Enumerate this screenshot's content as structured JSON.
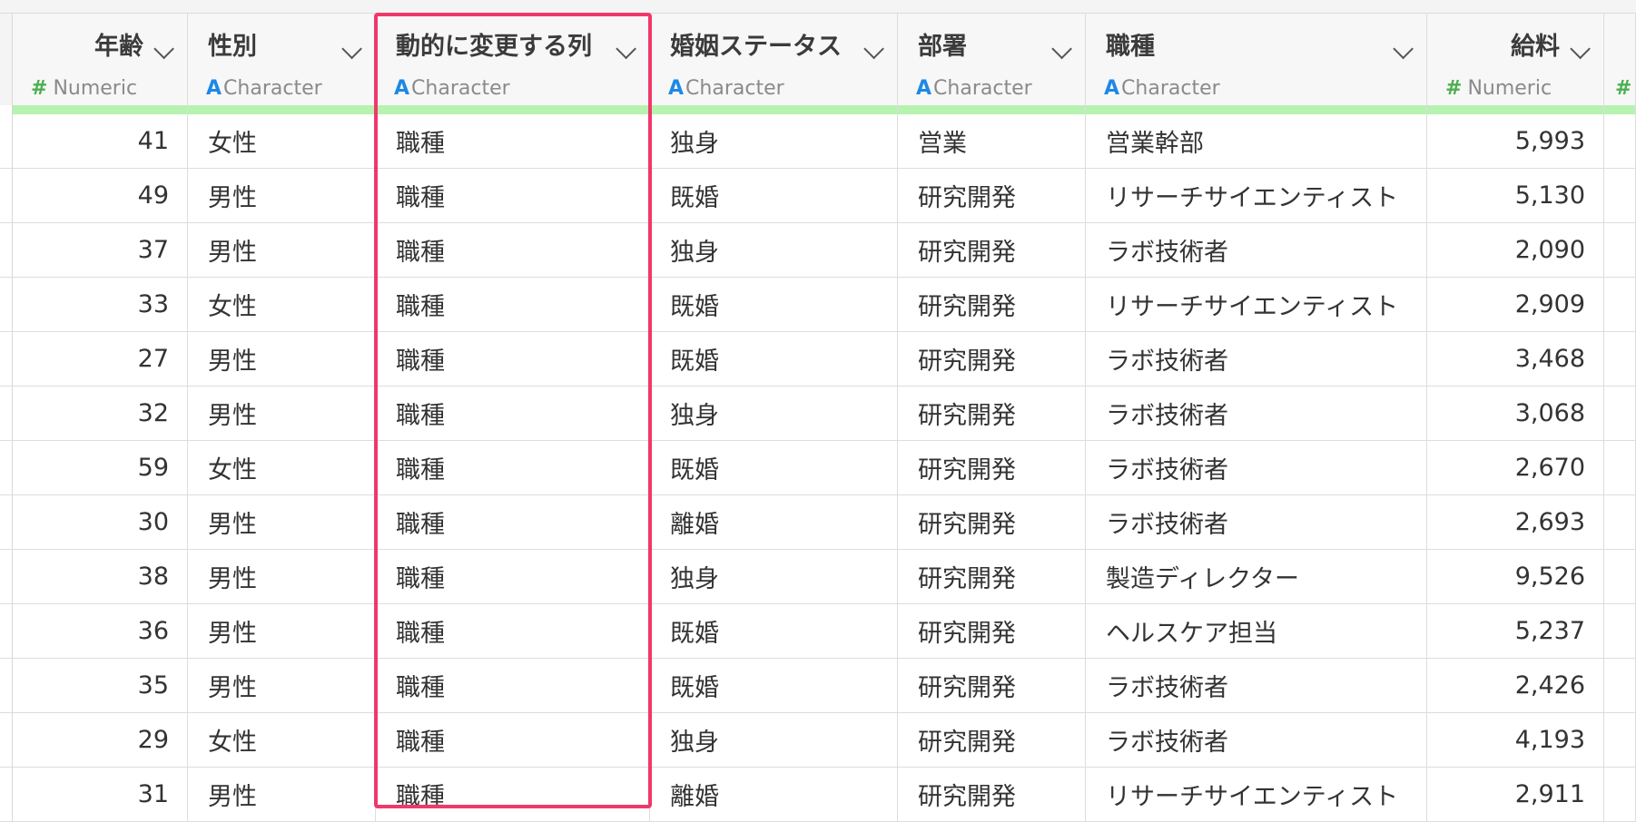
{
  "columns": [
    {
      "name": "年齢",
      "type_glyph": "#",
      "type": "Numeric"
    },
    {
      "name": "性別",
      "type_glyph": "A",
      "type": "Character"
    },
    {
      "name": "動的に変更する列",
      "type_glyph": "A",
      "type": "Character"
    },
    {
      "name": "婚姻ステータス",
      "type_glyph": "A",
      "type": "Character"
    },
    {
      "name": "部署",
      "type_glyph": "A",
      "type": "Character"
    },
    {
      "name": "職種",
      "type_glyph": "A",
      "type": "Character"
    },
    {
      "name": "給料",
      "type_glyph": "#",
      "type": "Numeric"
    }
  ],
  "partial_column_glyph": "#",
  "rows": [
    [
      "41",
      "女性",
      "職種",
      "独身",
      "営業",
      "営業幹部",
      "5,993"
    ],
    [
      "49",
      "男性",
      "職種",
      "既婚",
      "研究開発",
      "リサーチサイエンティスト",
      "5,130"
    ],
    [
      "37",
      "男性",
      "職種",
      "独身",
      "研究開発",
      "ラボ技術者",
      "2,090"
    ],
    [
      "33",
      "女性",
      "職種",
      "既婚",
      "研究開発",
      "リサーチサイエンティスト",
      "2,909"
    ],
    [
      "27",
      "男性",
      "職種",
      "既婚",
      "研究開発",
      "ラボ技術者",
      "3,468"
    ],
    [
      "32",
      "男性",
      "職種",
      "独身",
      "研究開発",
      "ラボ技術者",
      "3,068"
    ],
    [
      "59",
      "女性",
      "職種",
      "既婚",
      "研究開発",
      "ラボ技術者",
      "2,670"
    ],
    [
      "30",
      "男性",
      "職種",
      "離婚",
      "研究開発",
      "ラボ技術者",
      "2,693"
    ],
    [
      "38",
      "男性",
      "職種",
      "独身",
      "研究開発",
      "製造ディレクター",
      "9,526"
    ],
    [
      "36",
      "男性",
      "職種",
      "既婚",
      "研究開発",
      "ヘルスケア担当",
      "5,237"
    ],
    [
      "35",
      "男性",
      "職種",
      "既婚",
      "研究開発",
      "ラボ技術者",
      "2,426"
    ],
    [
      "29",
      "女性",
      "職種",
      "独身",
      "研究開発",
      "ラボ技術者",
      "4,193"
    ],
    [
      "31",
      "男性",
      "職種",
      "離婚",
      "研究開発",
      "リサーチサイエンティスト",
      "2,911"
    ]
  ],
  "colors": {
    "highlight": "#f0386b",
    "quality_bar": "#b6f2b0",
    "numeric_glyph": "#4caf50",
    "character_glyph": "#1e88e5"
  }
}
